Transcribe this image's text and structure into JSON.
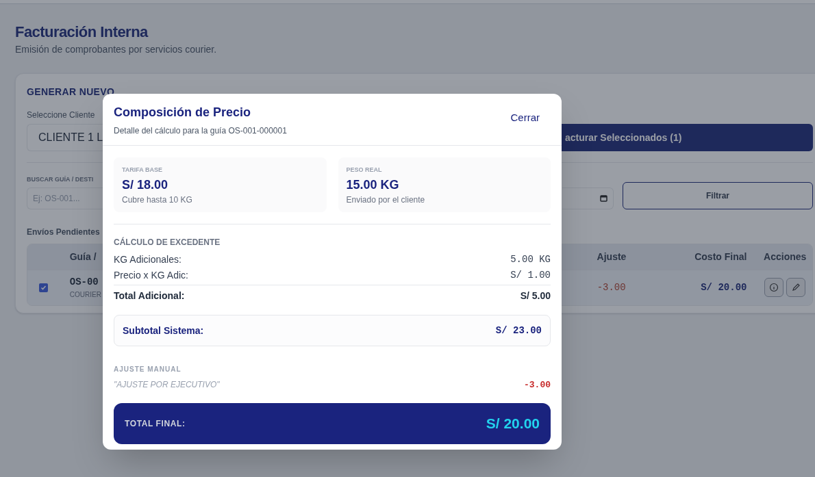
{
  "page": {
    "title": "Facturación Interna",
    "subtitle": "Emisión de comprobantes por servicios courier."
  },
  "generator": {
    "heading": "GENERAR NUEVO",
    "client_label": "Seleccione Cliente",
    "client_value": "CLIENTE 1 L",
    "invoice_button": "acturar Seleccionados (1)",
    "search_label": "BUSCAR GUÍA / DESTI",
    "search_placeholder": "Ej: OS-001...",
    "filter_button": "Filtrar",
    "pending_label": "Envíos Pendientes"
  },
  "table": {
    "columns": [
      "Guía /",
      "Ajuste",
      "Costo Final",
      "Acciones"
    ],
    "rows": [
      {
        "selected": true,
        "guide": "OS-00",
        "service": "COURIER",
        "adjustment": "-3.00",
        "final_cost": "S/ 20.00"
      }
    ]
  },
  "modal": {
    "title": "Composición de Precio",
    "subtitle": "Detalle del cálculo para la guía OS-001-000001",
    "close": "Cerrar",
    "stats": [
      {
        "label": "TARIFA BASE",
        "value": "S/ 18.00",
        "note": "Cubre hasta 10 KG"
      },
      {
        "label": "PESO REAL",
        "value": "15.00 KG",
        "note": "Enviado por el cliente"
      }
    ],
    "excess": {
      "heading": "CÁLCULO DE EXCEDENTE",
      "rows": [
        {
          "label": "KG Adicionales:",
          "value": "5.00 KG"
        },
        {
          "label": "Precio x KG Adic:",
          "value": "S/ 1.00"
        }
      ],
      "total": {
        "label": "Total Adicional:",
        "value": "S/ 5.00"
      }
    },
    "subtotal": {
      "label": "Subtotal Sistema:",
      "value": "S/ 23.00"
    },
    "adjustment": {
      "heading": "AJUSTE MANUAL",
      "reason": "\"AJUSTE POR EJECUTIVO\"",
      "value": "-3.00"
    },
    "total": {
      "label": "TOTAL FINAL:",
      "value": "S/ 20.00"
    }
  }
}
